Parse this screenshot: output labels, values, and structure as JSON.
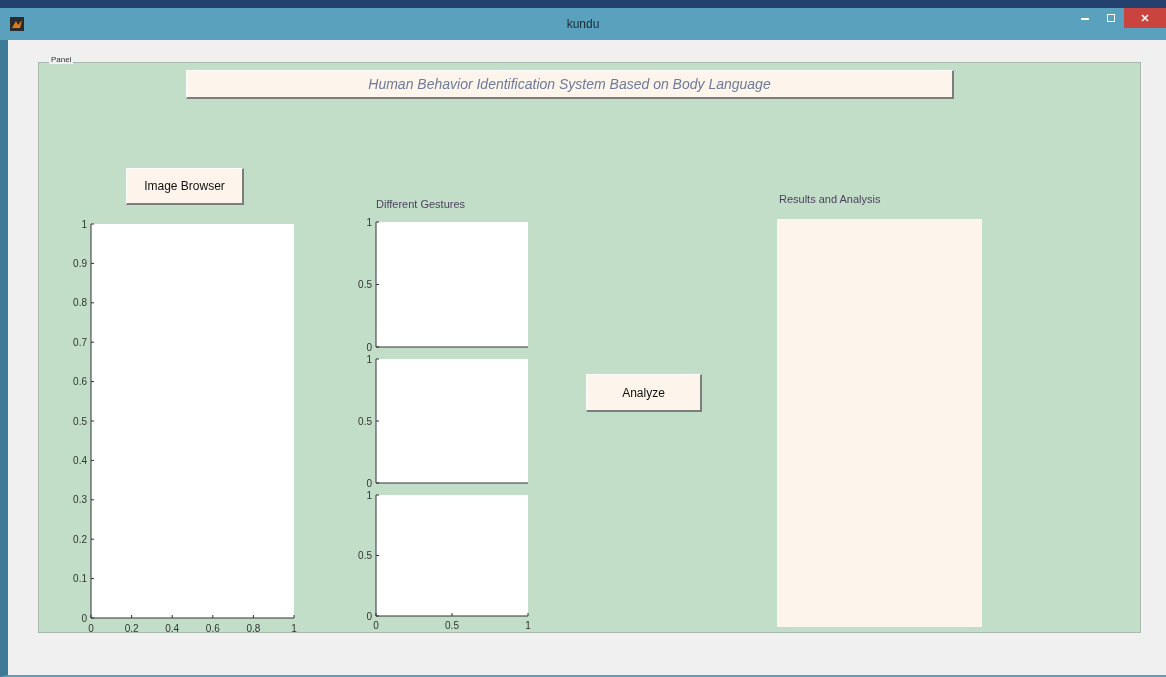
{
  "window": {
    "title": "kundu"
  },
  "panel": {
    "label": "Panel"
  },
  "heading": "Human Behavior Identification System Based on Body Language",
  "image_browser_button": "Image Browser",
  "image_axes": {
    "yticks": [
      "1",
      "0.9",
      "0.8",
      "0.7",
      "0.6",
      "0.5",
      "0.4",
      "0.3",
      "0.2",
      "0.1",
      "0"
    ],
    "xticks": [
      "0",
      "0.2",
      "0.4",
      "0.6",
      "0.8",
      "1"
    ]
  },
  "gestures": {
    "label": "Different Gestures",
    "axes": [
      {
        "yticks": [
          "1",
          "0.5",
          "0"
        ]
      },
      {
        "yticks": [
          "1",
          "0.5",
          "0"
        ]
      },
      {
        "yticks": [
          "1",
          "0.5",
          "0"
        ],
        "xticks": [
          "0",
          "0.5",
          "1"
        ]
      }
    ]
  },
  "analyze_button": "Analyze",
  "results": {
    "label": "Results and Analysis"
  }
}
